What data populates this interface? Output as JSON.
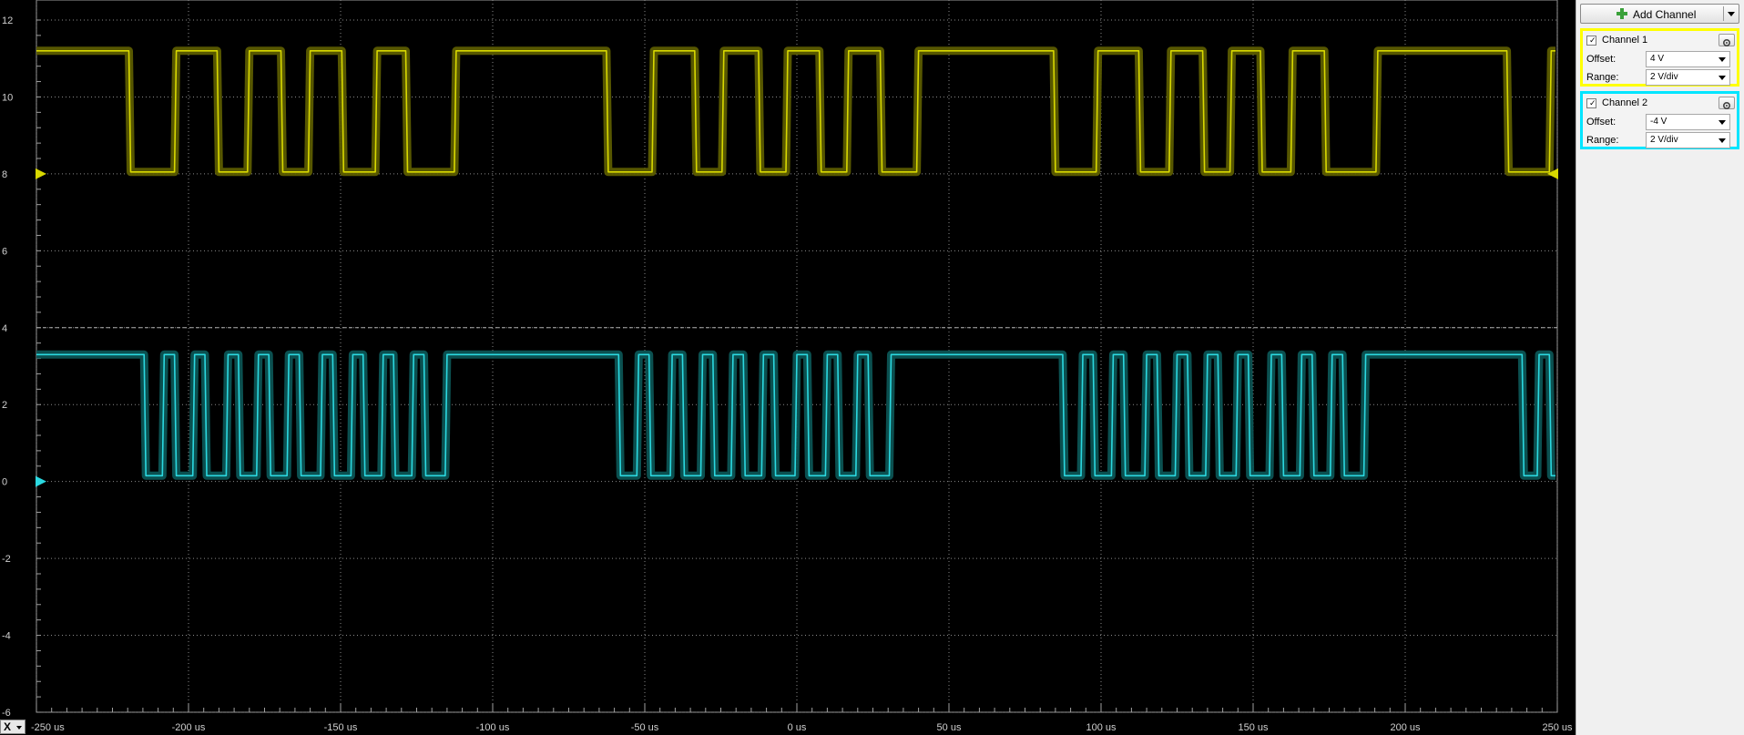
{
  "x_axis_selector": {
    "label": "X"
  },
  "panel": {
    "add_channel_label": "Add Channel",
    "channels": [
      {
        "name": "Channel 1",
        "enabled": true,
        "color": "#ffff00",
        "offset_label": "Offset:",
        "offset": "4 V",
        "range_label": "Range:",
        "range": "2 V/div"
      },
      {
        "name": "Channel 2",
        "enabled": true,
        "color": "#00e5ff",
        "offset_label": "Offset:",
        "offset": "-4 V",
        "range_label": "Range:",
        "range": "2 V/div"
      }
    ]
  },
  "chart_data": {
    "type": "line",
    "title": "",
    "xlabel": "",
    "ylabel": "",
    "xlim": [
      -250,
      250
    ],
    "ylim": [
      -6,
      12
    ],
    "x_ticks": [
      "-250 us",
      "-200 us",
      "-150 us",
      "-100 us",
      "-50 us",
      "0 us",
      "50 us",
      "100 us",
      "150 us",
      "200 us",
      "250 us"
    ],
    "x_tick_values": [
      -250,
      -200,
      -150,
      -100,
      -50,
      0,
      50,
      100,
      150,
      200,
      250
    ],
    "y_ticks": [
      "12",
      "10",
      "8",
      "6",
      "4",
      "2",
      "0",
      "-2",
      "-4",
      "-6"
    ],
    "y_tick_values": [
      12,
      10,
      8,
      6,
      4,
      2,
      0,
      -2,
      -4,
      -6
    ],
    "grid": true,
    "reference_line_y": 4,
    "series": [
      {
        "name": "Channel 1",
        "color": "#d8d800",
        "envelope_color": "#5c5c00",
        "marker_value": 8,
        "high": 11.2,
        "low": 8.05,
        "segments": [
          [
            -250,
            -219,
            1
          ],
          [
            -219,
            -204,
            0
          ],
          [
            -204,
            -190,
            1
          ],
          [
            -190,
            -180,
            0
          ],
          [
            -180,
            -169,
            1
          ],
          [
            -169,
            -160,
            0
          ],
          [
            -160,
            -149,
            1
          ],
          [
            -149,
            -138,
            0
          ],
          [
            -138,
            -128,
            1
          ],
          [
            -128,
            -112,
            0
          ],
          [
            -112,
            -62,
            1
          ],
          [
            -62,
            -47,
            0
          ],
          [
            -47,
            -33,
            1
          ],
          [
            -33,
            -24,
            0
          ],
          [
            -24,
            -12,
            1
          ],
          [
            -12,
            -3,
            0
          ],
          [
            -3,
            8,
            1
          ],
          [
            8,
            17,
            0
          ],
          [
            17,
            28,
            1
          ],
          [
            28,
            40,
            0
          ],
          [
            40,
            85,
            1
          ],
          [
            85,
            99,
            0
          ],
          [
            99,
            113,
            1
          ],
          [
            113,
            123,
            0
          ],
          [
            123,
            134,
            1
          ],
          [
            134,
            143,
            0
          ],
          [
            143,
            153,
            1
          ],
          [
            153,
            163,
            0
          ],
          [
            163,
            174,
            1
          ],
          [
            174,
            191,
            0
          ],
          [
            191,
            234,
            1
          ],
          [
            234,
            248,
            0
          ],
          [
            248,
            250,
            1
          ]
        ]
      },
      {
        "name": "Channel 2",
        "color": "#2bd8e0",
        "envelope_color": "#0c5454",
        "marker_value": 0,
        "high": 3.3,
        "low": 0.15,
        "segments": [
          [
            -250,
            -214,
            1
          ],
          [
            -214,
            -208,
            0
          ],
          [
            -208,
            -204,
            1
          ],
          [
            -204,
            -198,
            0
          ],
          [
            -198,
            -194,
            1
          ],
          [
            -194,
            -187,
            0
          ],
          [
            -187,
            -183,
            1
          ],
          [
            -183,
            -177,
            0
          ],
          [
            -177,
            -173,
            1
          ],
          [
            -173,
            -167,
            0
          ],
          [
            -167,
            -163,
            1
          ],
          [
            -163,
            -156,
            0
          ],
          [
            -156,
            -152,
            1
          ],
          [
            -152,
            -146,
            0
          ],
          [
            -146,
            -142,
            1
          ],
          [
            -142,
            -136,
            0
          ],
          [
            -136,
            -132,
            1
          ],
          [
            -132,
            -126,
            0
          ],
          [
            -126,
            -122,
            1
          ],
          [
            -122,
            -115,
            0
          ],
          [
            -115,
            -58,
            1
          ],
          [
            -58,
            -52,
            0
          ],
          [
            -52,
            -48,
            1
          ],
          [
            -48,
            -41,
            0
          ],
          [
            -41,
            -37,
            1
          ],
          [
            -37,
            -31,
            0
          ],
          [
            -31,
            -27,
            1
          ],
          [
            -27,
            -21,
            0
          ],
          [
            -21,
            -17,
            1
          ],
          [
            -17,
            -11,
            0
          ],
          [
            -11,
            -7,
            1
          ],
          [
            -7,
            0,
            0
          ],
          [
            0,
            4,
            1
          ],
          [
            4,
            10,
            0
          ],
          [
            10,
            14,
            1
          ],
          [
            14,
            20,
            0
          ],
          [
            20,
            24,
            1
          ],
          [
            24,
            31,
            0
          ],
          [
            31,
            88,
            1
          ],
          [
            88,
            94,
            0
          ],
          [
            94,
            98,
            1
          ],
          [
            98,
            104,
            0
          ],
          [
            104,
            108,
            1
          ],
          [
            108,
            115,
            0
          ],
          [
            115,
            119,
            1
          ],
          [
            119,
            125,
            0
          ],
          [
            125,
            129,
            1
          ],
          [
            125,
            129,
            1
          ],
          [
            129,
            135,
            0
          ],
          [
            135,
            139,
            1
          ],
          [
            139,
            145,
            0
          ],
          [
            145,
            149,
            1
          ],
          [
            149,
            156,
            0
          ],
          [
            156,
            160,
            1
          ],
          [
            160,
            166,
            0
          ],
          [
            166,
            170,
            1
          ],
          [
            170,
            176,
            0
          ],
          [
            176,
            180,
            1
          ],
          [
            180,
            187,
            0
          ],
          [
            187,
            239,
            1
          ],
          [
            239,
            244,
            0
          ],
          [
            244,
            248,
            1
          ],
          [
            248,
            250,
            0
          ]
        ]
      }
    ]
  }
}
